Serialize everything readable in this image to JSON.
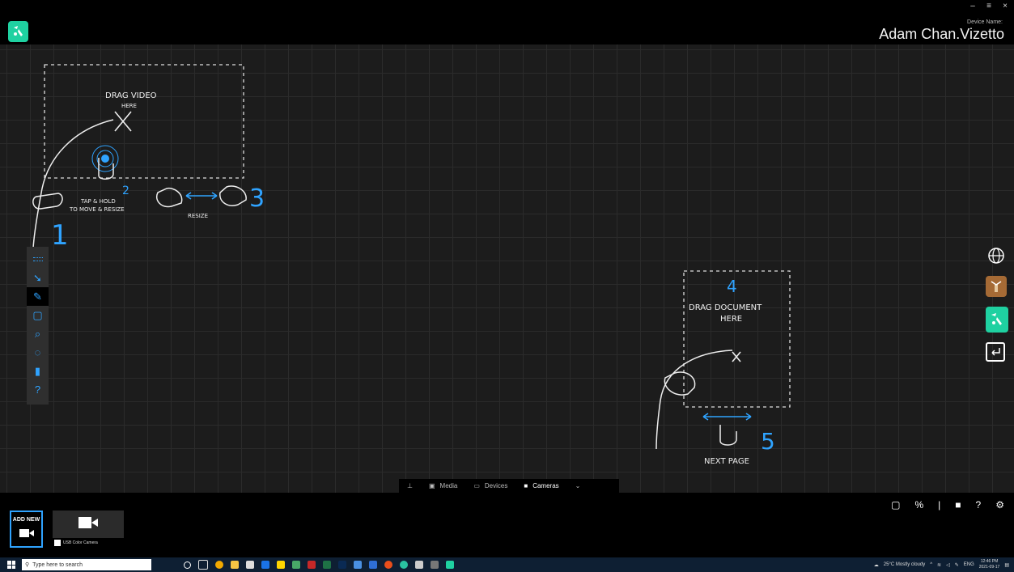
{
  "window": {
    "minimize": "–",
    "maximize": "≡",
    "close": "×"
  },
  "device": {
    "label": "Device Name:",
    "name": "Adam Chan.Vizetto"
  },
  "tutorial": {
    "drag_video": "DRAG VIDEO",
    "drag_video_2": "HERE",
    "tap_hold": "TAP & HOLD",
    "tap_hold_2": "TO MOVE & RESIZE",
    "resize": "RESIZE",
    "drag_document": "DRAG DOCUMENT",
    "drag_document_2": "HERE",
    "next_page": "NEXT PAGE",
    "step_1": "1",
    "step_2": "2",
    "step_3": "3",
    "step_4": "4",
    "step_5": "5"
  },
  "left_toolbar": {
    "help": "?"
  },
  "tabs": [
    {
      "label": "Media",
      "icon": "media-icon"
    },
    {
      "label": "Devices",
      "icon": "monitor-icon"
    },
    {
      "label": "Cameras",
      "icon": "camera-icon"
    }
  ],
  "bottom": {
    "add_new": "ADD NEW",
    "camera_caption": "USB Color Camera",
    "help": "?"
  },
  "taskbar": {
    "search_placeholder": "Type here to search",
    "weather": "25°C  Mostly cloudy",
    "language": "ENG",
    "time": "12:46 PM",
    "date": "2021-09-17"
  },
  "colors": {
    "accent": "#2fa3ff",
    "brand": "#1fd1a1",
    "background": "#1b1b1b"
  }
}
